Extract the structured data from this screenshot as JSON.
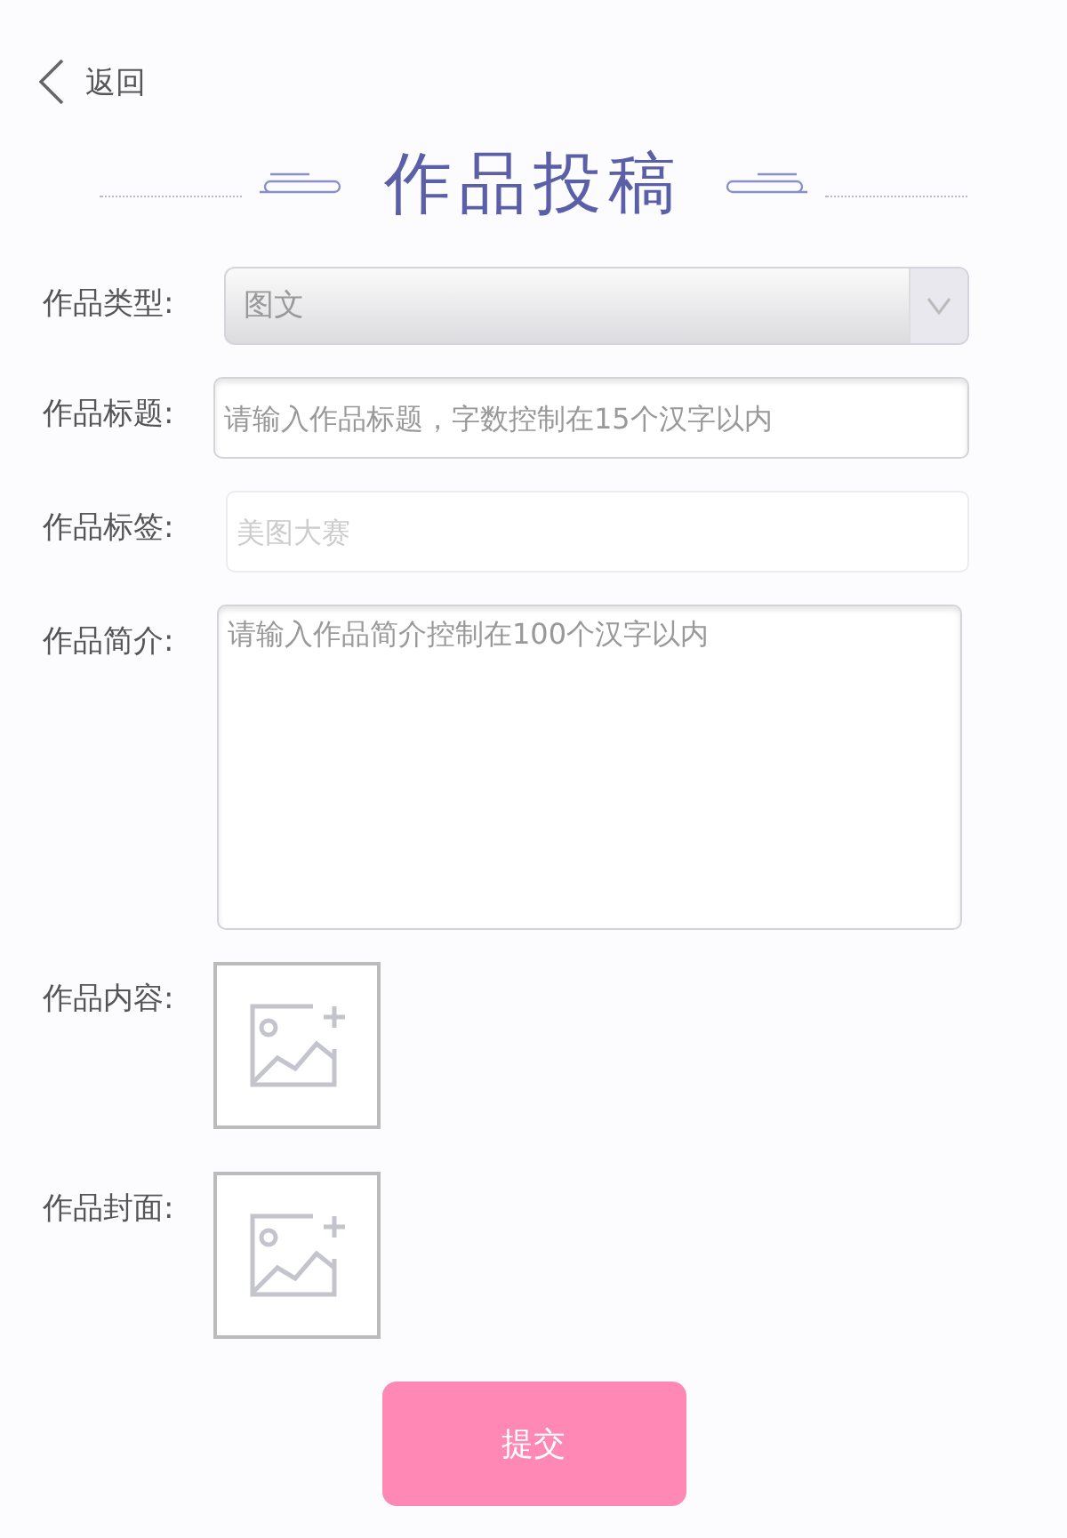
{
  "back": {
    "label": "返回"
  },
  "title": "作品投稿",
  "fields": [
    {
      "kind": "select",
      "label": "作品类型:",
      "value": "图文"
    },
    {
      "kind": "input",
      "label": "作品标题:",
      "placeholder": "请输入作品标题，字数控制在15个汉字以内",
      "disabled": false
    },
    {
      "kind": "input",
      "label": "作品标签:",
      "placeholder": "美图大赛",
      "disabled": true
    },
    {
      "kind": "textarea",
      "label": "作品简介:",
      "placeholder": "请输入作品简介控制在100个汉字以内"
    },
    {
      "kind": "upload",
      "label": "作品内容:"
    },
    {
      "kind": "upload",
      "label": "作品封面:"
    }
  ],
  "submit": {
    "label": "提交"
  }
}
